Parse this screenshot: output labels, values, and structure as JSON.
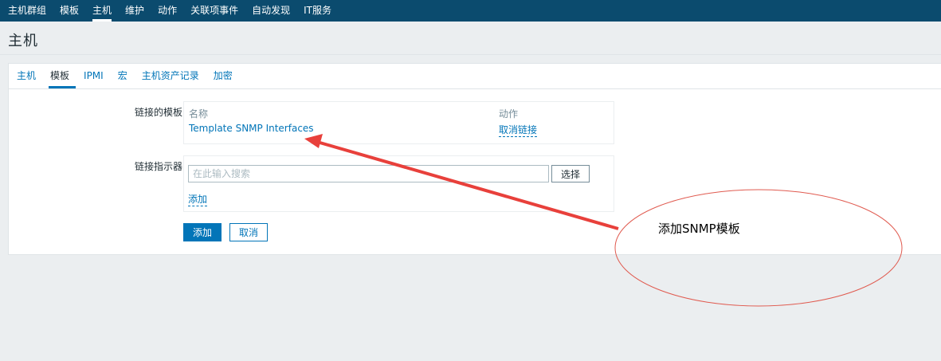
{
  "topnav": {
    "items": [
      {
        "label": "主机群组",
        "active": false
      },
      {
        "label": "模板",
        "active": false
      },
      {
        "label": "主机",
        "active": true
      },
      {
        "label": "维护",
        "active": false
      },
      {
        "label": "动作",
        "active": false
      },
      {
        "label": "关联项事件",
        "active": false
      },
      {
        "label": "自动发现",
        "active": false
      },
      {
        "label": "IT服务",
        "active": false
      }
    ]
  },
  "page": {
    "title": "主机"
  },
  "tabs": [
    {
      "label": "主机",
      "active": false
    },
    {
      "label": "模板",
      "active": true
    },
    {
      "label": "IPMI",
      "active": false
    },
    {
      "label": "宏",
      "active": false
    },
    {
      "label": "主机资产记录",
      "active": false
    },
    {
      "label": "加密",
      "active": false
    }
  ],
  "form": {
    "linked_templates_label": "链接的模板",
    "linked_templates": {
      "col_name": "名称",
      "col_action": "动作",
      "rows": [
        {
          "name": "Template SNMP Interfaces",
          "action": "取消链接"
        }
      ]
    },
    "link_indicator_label": "链接指示器",
    "search_placeholder": "在此输入搜索",
    "search_value": "",
    "select_button": "选择",
    "add_link": "添加",
    "submit_button": "添加",
    "cancel_button": "取消"
  },
  "annotation": {
    "text": "添加SNMP模板",
    "arrow_color": "#e8403b",
    "ellipse_color": "#e05a4f"
  },
  "colors": {
    "topnav_bg": "#0b4b6e",
    "link": "#0275b8",
    "page_bg": "#ebeef0"
  }
}
